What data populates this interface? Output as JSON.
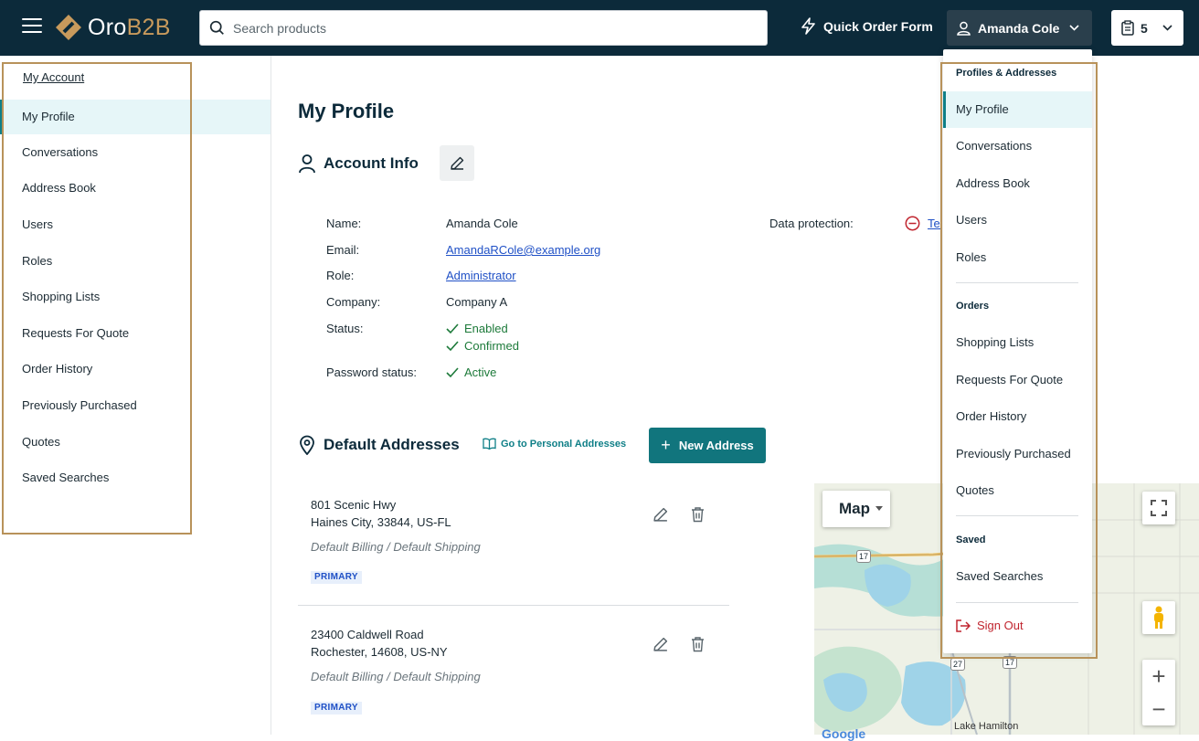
{
  "header": {
    "logo_text_a": "Oro",
    "logo_text_b": "B2B",
    "search_placeholder": "Search products",
    "quick_order": "Quick Order Form",
    "user_name": "Amanda Cole",
    "cart_count": "5"
  },
  "sidebar": {
    "title": "My Account",
    "items": [
      "My Profile",
      "Conversations",
      "Address Book",
      "Users",
      "Roles",
      "Shopping Lists",
      "Requests For Quote",
      "Order History",
      "Previously Purchased",
      "Quotes",
      "Saved Searches"
    ],
    "active": "My Profile"
  },
  "main": {
    "title": "My Profile",
    "account_info": {
      "heading": "Account Info",
      "fields": {
        "name_label": "Name:",
        "name": "Amanda Cole",
        "email_label": "Email:",
        "email": "AmandaRCole@example.org",
        "role_label": "Role:",
        "role": "Administrator",
        "company_label": "Company:",
        "company": "Company A",
        "status_label": "Status:",
        "status_1": "Enabled",
        "status_2": "Confirmed",
        "password_label": "Password status:",
        "password": "Active"
      },
      "data_protection_label": "Data protection:",
      "data_protection_link": "Terms"
    },
    "addresses": {
      "heading": "Default Addresses",
      "goto_link": "Go to Personal Addresses",
      "new_button": "New Address",
      "list": [
        {
          "line1": "801 Scenic Hwy",
          "line2": "Haines City, 33844, US-FL",
          "types": "Default Billing / Default Shipping",
          "badge": "PRIMARY"
        },
        {
          "line1": "23400 Caldwell Road",
          "line2": "Rochester, 14608, US-NY",
          "types": "Default Billing / Default Shipping",
          "badge": "PRIMARY"
        }
      ]
    },
    "map": {
      "type_label": "Map",
      "place_label": "Lake Hamilton",
      "google_label": "Google",
      "road_17": "17",
      "road_27": "27"
    }
  },
  "dropdown": {
    "sections": [
      {
        "heading": "Profiles & Addresses",
        "items": [
          "My Profile",
          "Conversations",
          "Address Book",
          "Users",
          "Roles"
        ]
      },
      {
        "heading": "Orders",
        "items": [
          "Shopping Lists",
          "Requests For Quote",
          "Order History",
          "Previously Purchased",
          "Quotes"
        ]
      },
      {
        "heading": "Saved",
        "items": [
          "Saved Searches"
        ]
      }
    ],
    "active": "My Profile",
    "sign_out": "Sign Out"
  },
  "colors": {
    "header_bg": "#0c2a3a",
    "accent": "#11757d",
    "highlight_box": "#b8925a",
    "link": "#1f50c6",
    "success": "#1d7a3a",
    "danger": "#c0242e"
  }
}
